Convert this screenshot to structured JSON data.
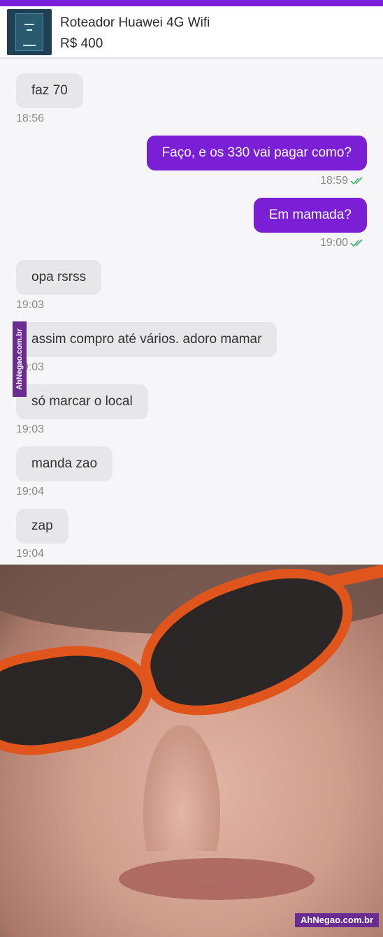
{
  "product": {
    "title": "Roteador Huawei 4G Wifi",
    "price": "R$ 400"
  },
  "messages": [
    {
      "side": "in",
      "text": "faz 70",
      "time": "18:56"
    },
    {
      "side": "out",
      "text": "Faço, e os 330 vai pagar como?",
      "time": "18:59",
      "read": true
    },
    {
      "side": "out",
      "text": "Em mamada?",
      "time": "19:00",
      "read": true
    },
    {
      "side": "in",
      "text": "opa rsrss",
      "time": "19:03"
    },
    {
      "side": "in",
      "text": "assim compro até vários. adoro mamar",
      "time": "19:03"
    },
    {
      "side": "in",
      "text": "só marcar o local",
      "time": "19:03"
    },
    {
      "side": "in",
      "text": "manda zao",
      "time": "19:04"
    },
    {
      "side": "in",
      "text": "zap",
      "time": "19:04"
    }
  ],
  "watermark": {
    "side": "AhNegao.com.br",
    "bottom": "AhNegao.com.br"
  },
  "colors": {
    "accent": "#7b1fd6",
    "incoming_bubble": "#e7e6e9",
    "read_ticks": "#3cb371"
  },
  "icons": {
    "read_receipt": "double-check-icon"
  }
}
